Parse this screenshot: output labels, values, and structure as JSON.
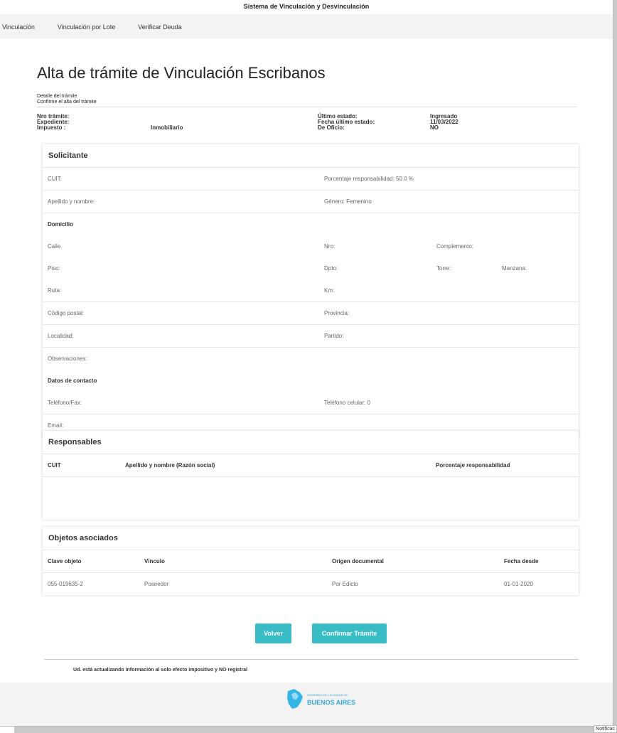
{
  "app_title": "Sistema de Vinculación y Desvinculación",
  "nav": [
    "Vinculación",
    "Vinculación por Lote",
    "Verificar Deuda"
  ],
  "page_title": "Alta de trámite de  Vinculación Escribanos",
  "detail": {
    "line1": "Detalle del trámite",
    "line2": "Confirme el alta del trámite"
  },
  "info": {
    "nro_tramite_label": "Nro trámite:",
    "expediente_label": "Expediente:",
    "impuesto_label": "Impuesto :",
    "impuesto_value": "Inmobiliario",
    "ultimo_estado_label": "Último estado:",
    "ultimo_estado_value": "Ingresado",
    "fecha_estado_label": "Fecha último estado:",
    "fecha_estado_value": "11/03/2022",
    "de_oficio_label": "De Oficio:",
    "de_oficio_value": "NO"
  },
  "solicitante": {
    "title": "Solicitante",
    "cuit": "CUIT:",
    "porcentaje": "Porcentaje responsabilidad:  50.0 %",
    "apellido": "Apellido y nombre:",
    "genero": "Género:   Femenino",
    "domicilio": "Domicilio",
    "calle": "Calle",
    "nro": "Nro:",
    "complemento": "Complemento:",
    "piso": "Piso:",
    "dpto": "Dpto:",
    "torre": "Torre:",
    "manzana": "Manzana:",
    "ruta": "Ruta:",
    "km": "Km:",
    "codigo_postal": "Código postal:",
    "provincia": "Provincia:",
    "localidad": "Localidad:",
    "partido": "Partido:",
    "observaciones": "Observaciones:",
    "datos_contacto": "Datos de contacto",
    "telefono": "Teléfono/Fax:",
    "celular": "Teléfono celular: 0",
    "email": "Email:"
  },
  "responsables": {
    "title": "Responsables",
    "headers": [
      "CUIT",
      "Apellido y nombre (Razón social)",
      "Porcentaje responsabilidad"
    ]
  },
  "objetos": {
    "title": "Objetos asociados",
    "headers": [
      "Clave objeto",
      "Vínculo",
      "Origen documental",
      "Fecha desde"
    ],
    "rows": [
      [
        "055-019635-2",
        "Poseedor",
        "Por Edicto",
        "01-01-2020"
      ]
    ]
  },
  "buttons": {
    "volver": "Volver",
    "confirmar": "Confirmar Trámite"
  },
  "footnote": "Ud. está actualizando información al solo efecto impositivo y NO registral",
  "footer": {
    "logo_small": "GOBIERNO DE LA CIUDAD DE",
    "logo_text": "BUENOS AIRES"
  },
  "notif": "Notificac"
}
